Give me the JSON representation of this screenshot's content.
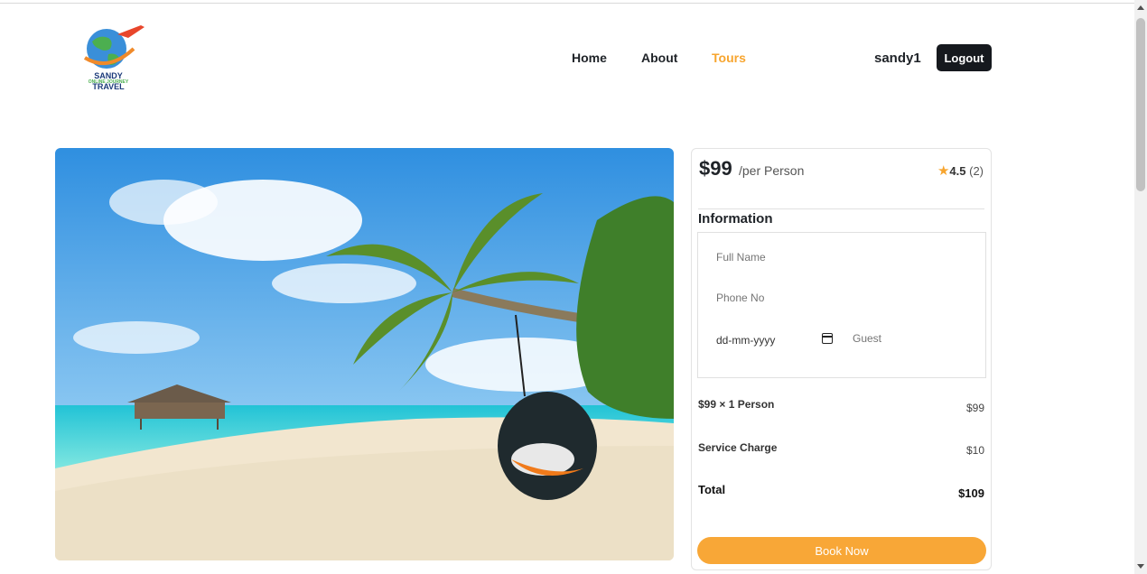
{
  "header": {
    "logo_line1": "SANDY",
    "logo_line2": "ONLINE JOURNEY",
    "logo_line3": "TRAVEL",
    "nav": [
      {
        "label": "Home",
        "active": false
      },
      {
        "label": "About",
        "active": false
      },
      {
        "label": "Tours",
        "active": true
      }
    ],
    "username": "sandy1",
    "logout_label": "Logout"
  },
  "tour": {
    "image_alt": "Tropical beach with palm tree and hanging swing chair"
  },
  "booking": {
    "price": "$99",
    "per_label": "/per Person",
    "rating": "4.5",
    "rating_count": "(2)",
    "info_title": "Information",
    "full_name_placeholder": "Full Name",
    "phone_placeholder": "Phone No",
    "date_placeholder": "dd-mm-yyyy",
    "guest_placeholder": "Guest",
    "rows": [
      {
        "label": "$99 × 1 Person",
        "value": "$99"
      },
      {
        "label": "Service Charge",
        "value": "$10"
      }
    ],
    "total_label": "Total",
    "total_value": "$109",
    "book_label": "Book Now"
  },
  "colors": {
    "accent": "#f7a52f",
    "dark": "#16191e"
  }
}
